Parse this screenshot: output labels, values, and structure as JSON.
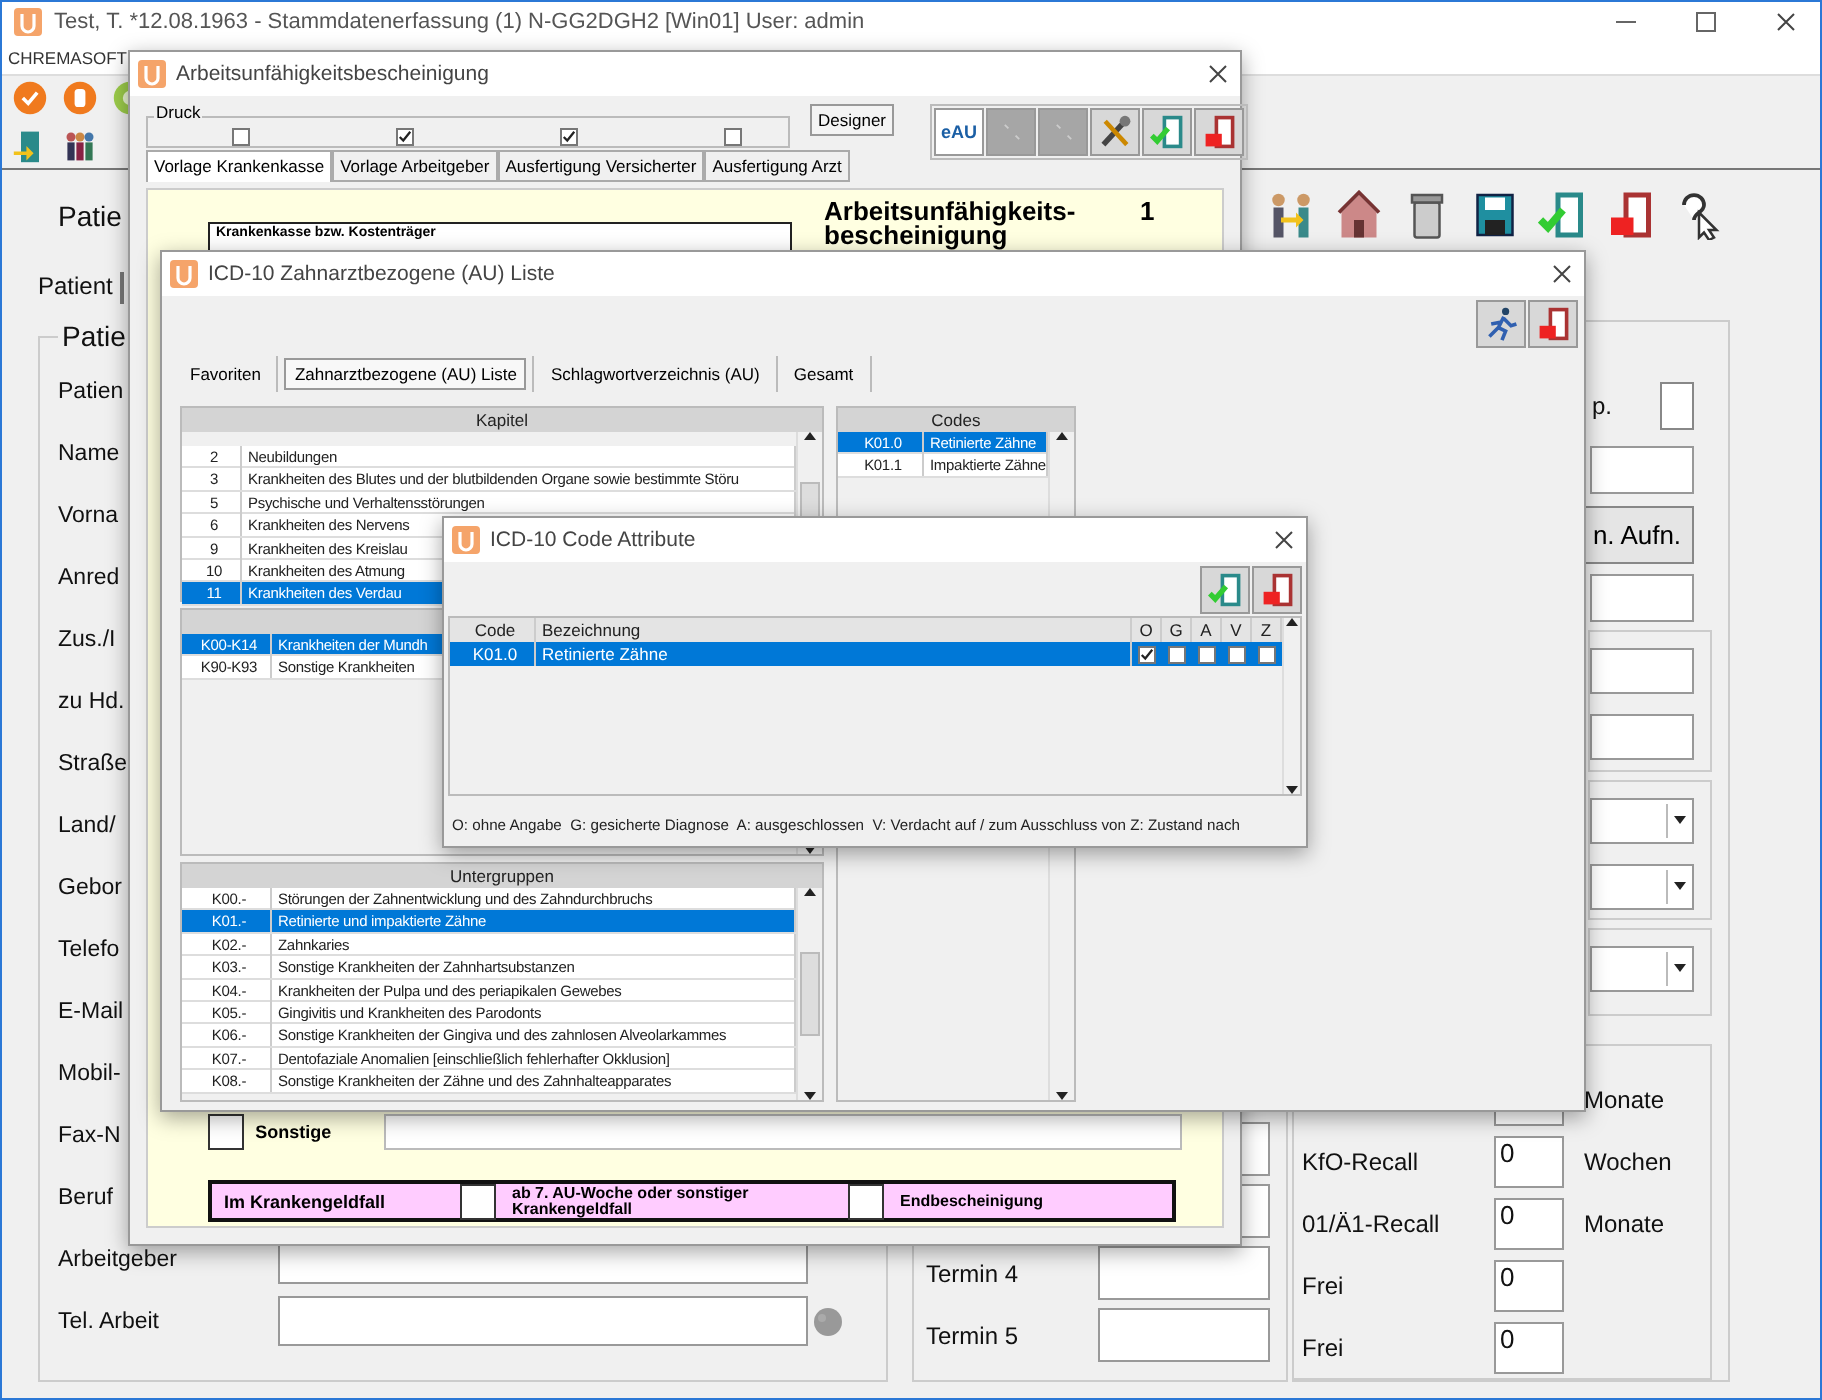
{
  "main_window": {
    "title": "Test, T. *12.08.1963 - Stammdatenerfassung (1) N-GG2DGH2 [Win01] User: admin",
    "menu": "CHREMASOFT",
    "heading": "Patie",
    "tab": {
      "label": "Patient",
      "selected": true
    },
    "patient_group": {
      "legend": "Patie",
      "rows": [
        {
          "label": "Patien",
          "kind": "label"
        },
        {
          "label": "Name",
          "kind": "label"
        },
        {
          "label": "Vorna",
          "kind": "label"
        },
        {
          "label": "Anred",
          "kind": "label"
        },
        {
          "label": "Zus./I",
          "kind": "label"
        },
        {
          "label": "zu Hd.",
          "kind": "label"
        },
        {
          "label": "Straße",
          "kind": "label"
        },
        {
          "label": "Land/",
          "kind": "label"
        },
        {
          "label": "Gebor",
          "kind": "label"
        },
        {
          "label": "Telefo",
          "kind": "label"
        },
        {
          "label": "E-Mail",
          "kind": "label"
        },
        {
          "label": "Mobil-",
          "kind": "label"
        },
        {
          "label": "Fax-N",
          "kind": "label"
        },
        {
          "label": "Beruf",
          "kind": "label"
        },
        {
          "label": "Arbeitgeber",
          "kind": "field"
        },
        {
          "label": "Tel. Arbeit",
          "kind": "field"
        }
      ]
    },
    "termine": [
      {
        "kind": "field"
      },
      {
        "kind": "field"
      },
      {
        "kind": "labeled",
        "label": "Termin 4"
      },
      {
        "kind": "labeled",
        "label": "Termin 5"
      }
    ],
    "side": {
      "checkbox_label": "p.",
      "checked": false,
      "button": "n. Aufn."
    },
    "recalls": [
      {
        "unit": "Monate"
      },
      {
        "label": "KfO-Recall",
        "value": "0",
        "unit": "Wochen"
      },
      {
        "label": "01/Ä1-Recall",
        "value": "0",
        "unit": "Monate"
      },
      {
        "label": "Frei",
        "value": "0"
      },
      {
        "label": "Frei",
        "value": "0"
      }
    ]
  },
  "au_dialog": {
    "title": "Arbeitsunfähigkeitsbescheinigung",
    "druck_legend": "Druck",
    "druck": [
      {
        "checked": false
      },
      {
        "checked": true
      },
      {
        "checked": true
      },
      {
        "checked": false
      }
    ],
    "designer": "Designer",
    "eau": "eAU",
    "toolbar": [
      {
        "disabled": true
      },
      {
        "disabled": true
      },
      {
        "disabled": false
      },
      {
        "disabled": false
      },
      {
        "disabled": false
      }
    ],
    "tabs": [
      {
        "label": "Vorlage Krankenkasse",
        "selected": true
      },
      {
        "label": "Vorlage Arbeitgeber",
        "selected": false
      },
      {
        "label": "Ausfertigung Versicherter",
        "selected": false
      },
      {
        "label": "Ausfertigung Arzt",
        "selected": false
      }
    ],
    "insurer_caption": "Krankenkasse bzw. Kostenträger",
    "form_title": "Arbeitsunfähigkeits-",
    "form_title_2": "bescheinigung",
    "form_number": "1",
    "other": {
      "label": "Sonstige",
      "checked": false
    },
    "sick_pay": {
      "label": "Im Krankengeldfall",
      "option_1": {
        "label": "ab 7. AU-Woche oder sonstiger Krankengeldfall",
        "checked": false
      },
      "option_2": {
        "label": "Endbescheinigung",
        "checked": false
      }
    }
  },
  "icd_dialog": {
    "title": "ICD-10 Zahnarztbezogene (AU) Liste",
    "tabs": [
      {
        "label": "Favoriten",
        "selected": false
      },
      {
        "label": "Zahnarztbezogene (AU) Liste",
        "selected": true
      },
      {
        "label": "Schlagwortverzeichnis (AU)",
        "selected": false
      },
      {
        "label": "Gesamt",
        "selected": false
      }
    ],
    "kapitel": {
      "header": "Kapitel",
      "rows": [
        {
          "code": "2",
          "text": "Neubildungen",
          "selected": false
        },
        {
          "code": "3",
          "text": "Krankheiten des Blutes und der blutbildenden Organe sowie bestimmte Störu",
          "selected": false
        },
        {
          "code": "5",
          "text": "Psychische und Verhaltensstörungen",
          "selected": false
        },
        {
          "code": "6",
          "text": "Krankheiten des Nervens",
          "selected": false
        },
        {
          "code": "9",
          "text": "Krankheiten des Kreislau",
          "selected": false
        },
        {
          "code": "10",
          "text": "Krankheiten des Atmung",
          "selected": false
        },
        {
          "code": "11",
          "text": "Krankheiten des Verdau",
          "selected": true
        }
      ]
    },
    "gruppen": {
      "rows": [
        {
          "code": "K00-K14",
          "text": "Krankheiten der Mundh",
          "selected": true
        },
        {
          "code": "K90-K93",
          "text": "Sonstige Krankheiten",
          "selected": false
        }
      ]
    },
    "untergruppen": {
      "header": "Untergruppen",
      "rows": [
        {
          "code": "K00.-",
          "text": "Störungen der Zahnentwicklung und des Zahndurchbruchs",
          "selected": false
        },
        {
          "code": "K01.-",
          "text": "Retinierte und impaktierte Zähne",
          "selected": true
        },
        {
          "code": "K02.-",
          "text": "Zahnkaries",
          "selected": false
        },
        {
          "code": "K03.-",
          "text": "Sonstige Krankheiten der Zahnhartsubstanzen",
          "selected": false
        },
        {
          "code": "K04.-",
          "text": "Krankheiten der Pulpa und des periapikalen Gewebes",
          "selected": false
        },
        {
          "code": "K05.-",
          "text": "Gingivitis und Krankheiten des Parodonts",
          "selected": false
        },
        {
          "code": "K06.-",
          "text": "Sonstige Krankheiten der Gingiva und des zahnlosen Alveolarkammes",
          "selected": false
        },
        {
          "code": "K07.-",
          "text": "Dentofaziale Anomalien [einschließlich fehlerhafter Okklusion]",
          "selected": false
        },
        {
          "code": "K08.-",
          "text": "Sonstige Krankheiten der Zähne und des Zahnhalteapparates",
          "selected": false
        }
      ]
    },
    "codes": {
      "header": "Codes",
      "rows": [
        {
          "code": "K01.0",
          "text": "Retinierte Zähne",
          "selected": true
        },
        {
          "code": "K01.1",
          "text": "Impaktierte Zähne",
          "selected": false
        }
      ]
    }
  },
  "attribute_dialog": {
    "title": "ICD-10 Code Attribute",
    "columns": {
      "code": "Code",
      "name": "Bezeichnung",
      "flags": [
        "O",
        "G",
        "A",
        "V",
        "Z"
      ]
    },
    "rows": [
      {
        "code": "K01.0",
        "text": "Retinierte Zähne",
        "selected": true,
        "flags": [
          {
            "checked": true
          },
          {
            "checked": false
          },
          {
            "checked": false
          },
          {
            "checked": false
          },
          {
            "checked": false
          }
        ]
      }
    ],
    "legend": "O: ohne Angabe  G: gesicherte Diagnose  A: ausgeschlossen  V: Verdacht auf / zum Ausschluss von Z: Zustand nach"
  }
}
